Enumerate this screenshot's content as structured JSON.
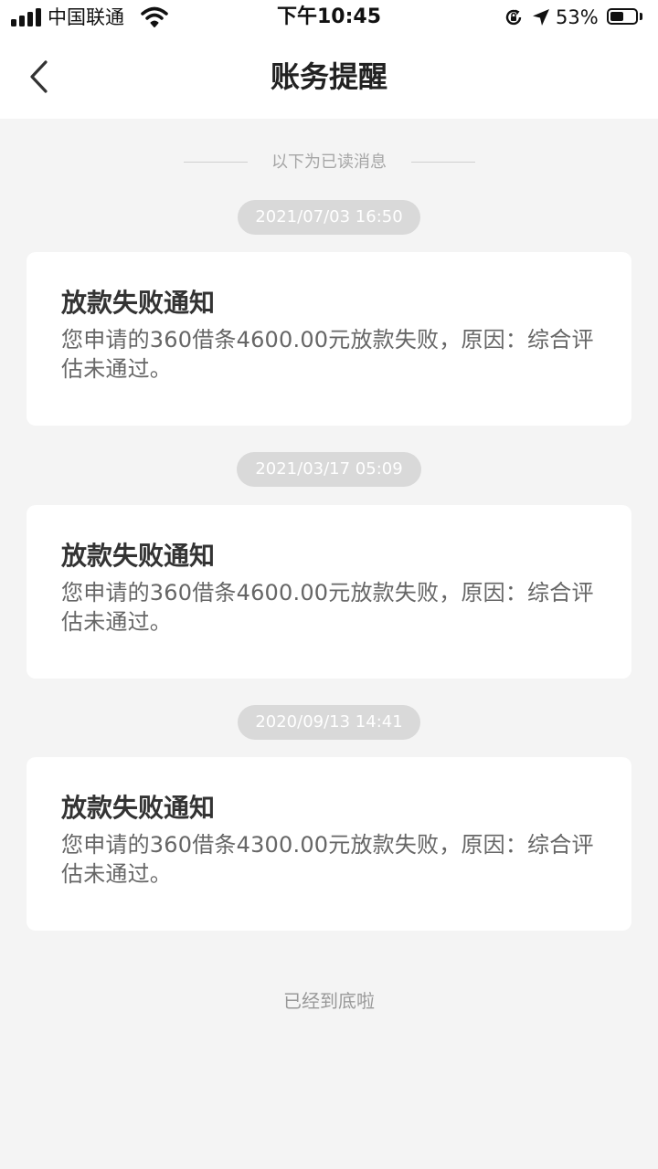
{
  "status_bar": {
    "carrier": "中国联通",
    "time": "下午10:45",
    "battery_percent": "53%",
    "battery_level": 0.53,
    "icons": [
      "signal-icon",
      "wifi-icon",
      "rotation-lock-icon",
      "location-icon",
      "battery-icon"
    ]
  },
  "nav": {
    "back_icon": "chevron-left-icon",
    "title": "账务提醒"
  },
  "divider": {
    "label": "以下为已读消息"
  },
  "messages": [
    {
      "timestamp": "2021/07/03 16:50",
      "title": "放款失败通知",
      "body": "您申请的360借条4600.00元放款失败，原因：综合评估未通过。"
    },
    {
      "timestamp": "2021/03/17 05:09",
      "title": "放款失败通知",
      "body": "您申请的360借条4600.00元放款失败，原因：综合评估未通过。"
    },
    {
      "timestamp": "2020/09/13 14:41",
      "title": "放款失败通知",
      "body": "您申请的360借条4300.00元放款失败，原因：综合评估未通过。"
    }
  ],
  "footer": {
    "end_label": "已经到底啦"
  },
  "colors": {
    "page_background": "#f4f4f4",
    "card_background": "#ffffff",
    "timestamp_pill": "#d9d9d9",
    "title_text": "#333333",
    "body_text": "#666666",
    "muted_text": "#a6a6a6"
  }
}
